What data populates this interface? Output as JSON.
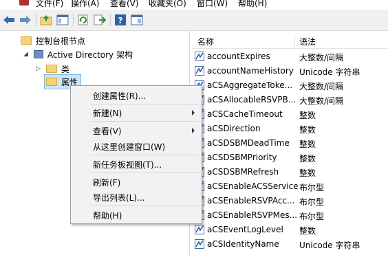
{
  "menubar": {
    "file": "文件(F)",
    "action": "操作(A)",
    "view": "查看(V)",
    "favorites": "收藏夹(O)",
    "window": "窗口(W)",
    "help": "帮助(H)"
  },
  "toolbar": {
    "icons": [
      "back-icon",
      "forward-icon",
      "up-folder-icon",
      "show-tree-icon",
      "refresh-icon",
      "export-icon",
      "help-icon",
      "pane-icon"
    ]
  },
  "tree": {
    "root": "控制台根节点",
    "ad": "Active Directory 架构",
    "classes": "类",
    "attributes": "属性"
  },
  "list": {
    "col_name": "名称",
    "col_syntax": "语法",
    "rows": [
      {
        "name": "accountExpires",
        "syntax": "大整数/间隔"
      },
      {
        "name": "accountNameHistory",
        "syntax": "Unicode 字符串"
      },
      {
        "name": "aCSAggregateToke...",
        "syntax": "大整数/间隔"
      },
      {
        "name": "aCSAllocableRSVPB...",
        "syntax": "大整数/间隔"
      },
      {
        "name": "aCSCacheTimeout",
        "syntax": "整数"
      },
      {
        "name": "aCSDirection",
        "syntax": "整数"
      },
      {
        "name": "aCSDSBMDeadTime",
        "syntax": "整数"
      },
      {
        "name": "aCSDSBMPriority",
        "syntax": "整数"
      },
      {
        "name": "aCSDSBMRefresh",
        "syntax": "整数"
      },
      {
        "name": "aCSEnableACSService",
        "syntax": "布尔型"
      },
      {
        "name": "aCSEnableRSVPAcc...",
        "syntax": "布尔型"
      },
      {
        "name": "aCSEnableRSVPMes...",
        "syntax": "布尔型"
      },
      {
        "name": "aCSEventLogLevel",
        "syntax": "整数"
      },
      {
        "name": "aCSIdentityName",
        "syntax": "Unicode 字符串"
      }
    ]
  },
  "context_menu": {
    "create_attribute": "创建属性(R)...",
    "new": "新建(N)",
    "view": "查看(V)",
    "new_window": "从这里创建窗口(W)",
    "taskpad": "新任务板视图(T)...",
    "refresh": "刷新(F)",
    "export": "导出列表(L)...",
    "help": "帮助(H)"
  },
  "colors": {
    "toolbar_bg": "#f0f0f0",
    "menu_bg": "#f2f2f2",
    "folder": "#f3d47a",
    "accent": "#2f6db5"
  }
}
